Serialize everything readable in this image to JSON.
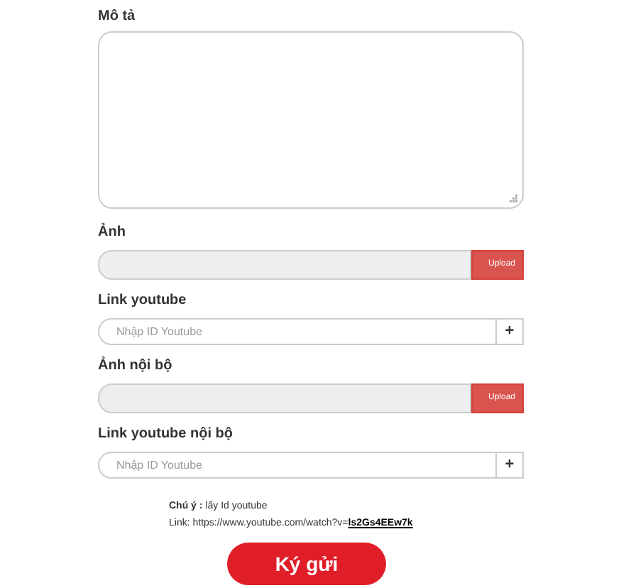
{
  "description": {
    "label": "Mô tả"
  },
  "fields": [
    {
      "kind": "upload",
      "label": "Ảnh",
      "button": "Upload"
    },
    {
      "kind": "link",
      "label": "Link youtube",
      "placeholder": "Nhập ID Youtube",
      "button": "+"
    },
    {
      "kind": "upload",
      "label": "Ảnh nội bộ",
      "button": "Upload"
    },
    {
      "kind": "link",
      "label": "Link youtube nội bộ",
      "placeholder": "Nhập ID Youtube",
      "button": "+"
    }
  ],
  "note": {
    "line_1": "**Chú ý :** lấy Id youtube",
    "line_2": "Link: https://www.youtube.com/watch?v=",
    "link": "ls2Gs4EEw7k"
  },
  "submit": "Ký gửi"
}
